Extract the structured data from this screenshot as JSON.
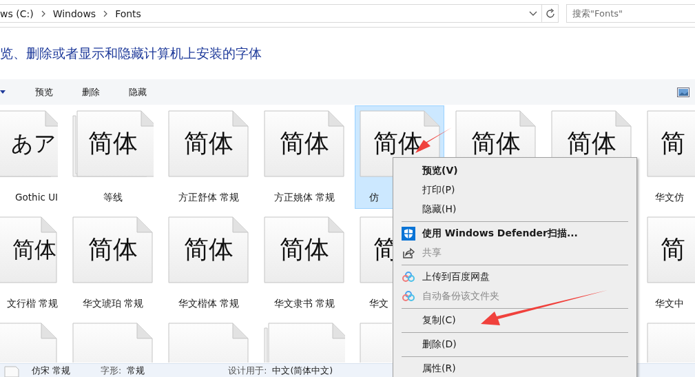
{
  "address_bar": {
    "breadcrumbs": [
      "ws (C:)",
      "Windows",
      "Fonts"
    ]
  },
  "search": {
    "placeholder": "搜索\"Fonts\""
  },
  "header": "览、删除或者显示和隐藏计算机上安装的字体",
  "toolbar": {
    "buttons": [
      "预览",
      "删除",
      "隐藏"
    ]
  },
  "rows": [
    [
      {
        "preview": "あア",
        "label": "Gothic UI",
        "stacked": true,
        "selected": false
      },
      {
        "preview": "简体",
        "label": "等线",
        "stacked": true,
        "selected": false
      },
      {
        "preview": "简体",
        "label": "方正舒体 常规",
        "stacked": false,
        "selected": false
      },
      {
        "preview": "简体",
        "label": "方正姚体 常规",
        "stacked": false,
        "selected": false
      },
      {
        "preview": "简体",
        "label": "仿",
        "stacked": false,
        "selected": true
      },
      {
        "preview": "简体",
        "stacked": false,
        "selected": false
      },
      {
        "preview": "简体",
        "stacked": false,
        "selected": false
      },
      {
        "preview": "简",
        "label": "华文仿",
        "stacked": false,
        "selected": false
      }
    ],
    [
      {
        "preview": "简体",
        "label": "文行楷 常规",
        "stacked": false,
        "selected": false
      },
      {
        "preview": "简体",
        "label": "华文琥珀 常规",
        "stacked": false,
        "selected": false
      },
      {
        "preview": "简体",
        "label": "华文楷体 常规",
        "stacked": false,
        "selected": false
      },
      {
        "preview": "简体",
        "label": "华文隶书 常规",
        "stacked": false,
        "selected": false
      },
      {
        "preview": "简",
        "label": "华文",
        "stacked": false,
        "selected": false
      },
      null,
      null,
      {
        "preview": "简",
        "label": "华文中",
        "stacked": false,
        "selected": false
      }
    ],
    [
      {
        "stacked": false,
        "selected": false
      },
      {
        "stacked": false,
        "selected": false
      },
      {
        "stacked": false,
        "selected": false
      },
      {
        "stacked": true,
        "selected": false
      },
      {
        "stacked": false,
        "selected": false
      },
      null,
      null,
      {
        "stacked": false,
        "selected": false
      }
    ]
  ],
  "details": {
    "name": "仿宋 常规",
    "style_label": "字形:",
    "style_value": "常规",
    "designed_label": "设计用于:",
    "designed_value": "中文(简体中文)"
  },
  "context_menu": [
    {
      "kind": "plain",
      "label": "预览(V)",
      "bold": true,
      "disabled": false
    },
    {
      "kind": "plain",
      "label": "打印(P)",
      "bold": false,
      "disabled": false
    },
    {
      "kind": "plain",
      "label": "隐藏(H)",
      "bold": false,
      "disabled": false
    },
    {
      "kind": "separator"
    },
    {
      "kind": "shield",
      "label": "使用 Windows Defender扫描...",
      "bold": true,
      "disabled": false
    },
    {
      "kind": "share",
      "label": "共享",
      "bold": false,
      "disabled": true
    },
    {
      "kind": "separator"
    },
    {
      "kind": "cloud",
      "label": "上传到百度网盘",
      "bold": false,
      "disabled": false
    },
    {
      "kind": "cloud",
      "label": "自动备份该文件夹",
      "bold": false,
      "disabled": true
    },
    {
      "kind": "separator"
    },
    {
      "kind": "plain",
      "label": "复制(C)",
      "bold": false,
      "disabled": false
    },
    {
      "kind": "separator"
    },
    {
      "kind": "plain",
      "label": "删除(D)",
      "bold": false,
      "disabled": false
    },
    {
      "kind": "separator"
    },
    {
      "kind": "plain",
      "label": "属性(R)",
      "bold": false,
      "disabled": false
    }
  ]
}
